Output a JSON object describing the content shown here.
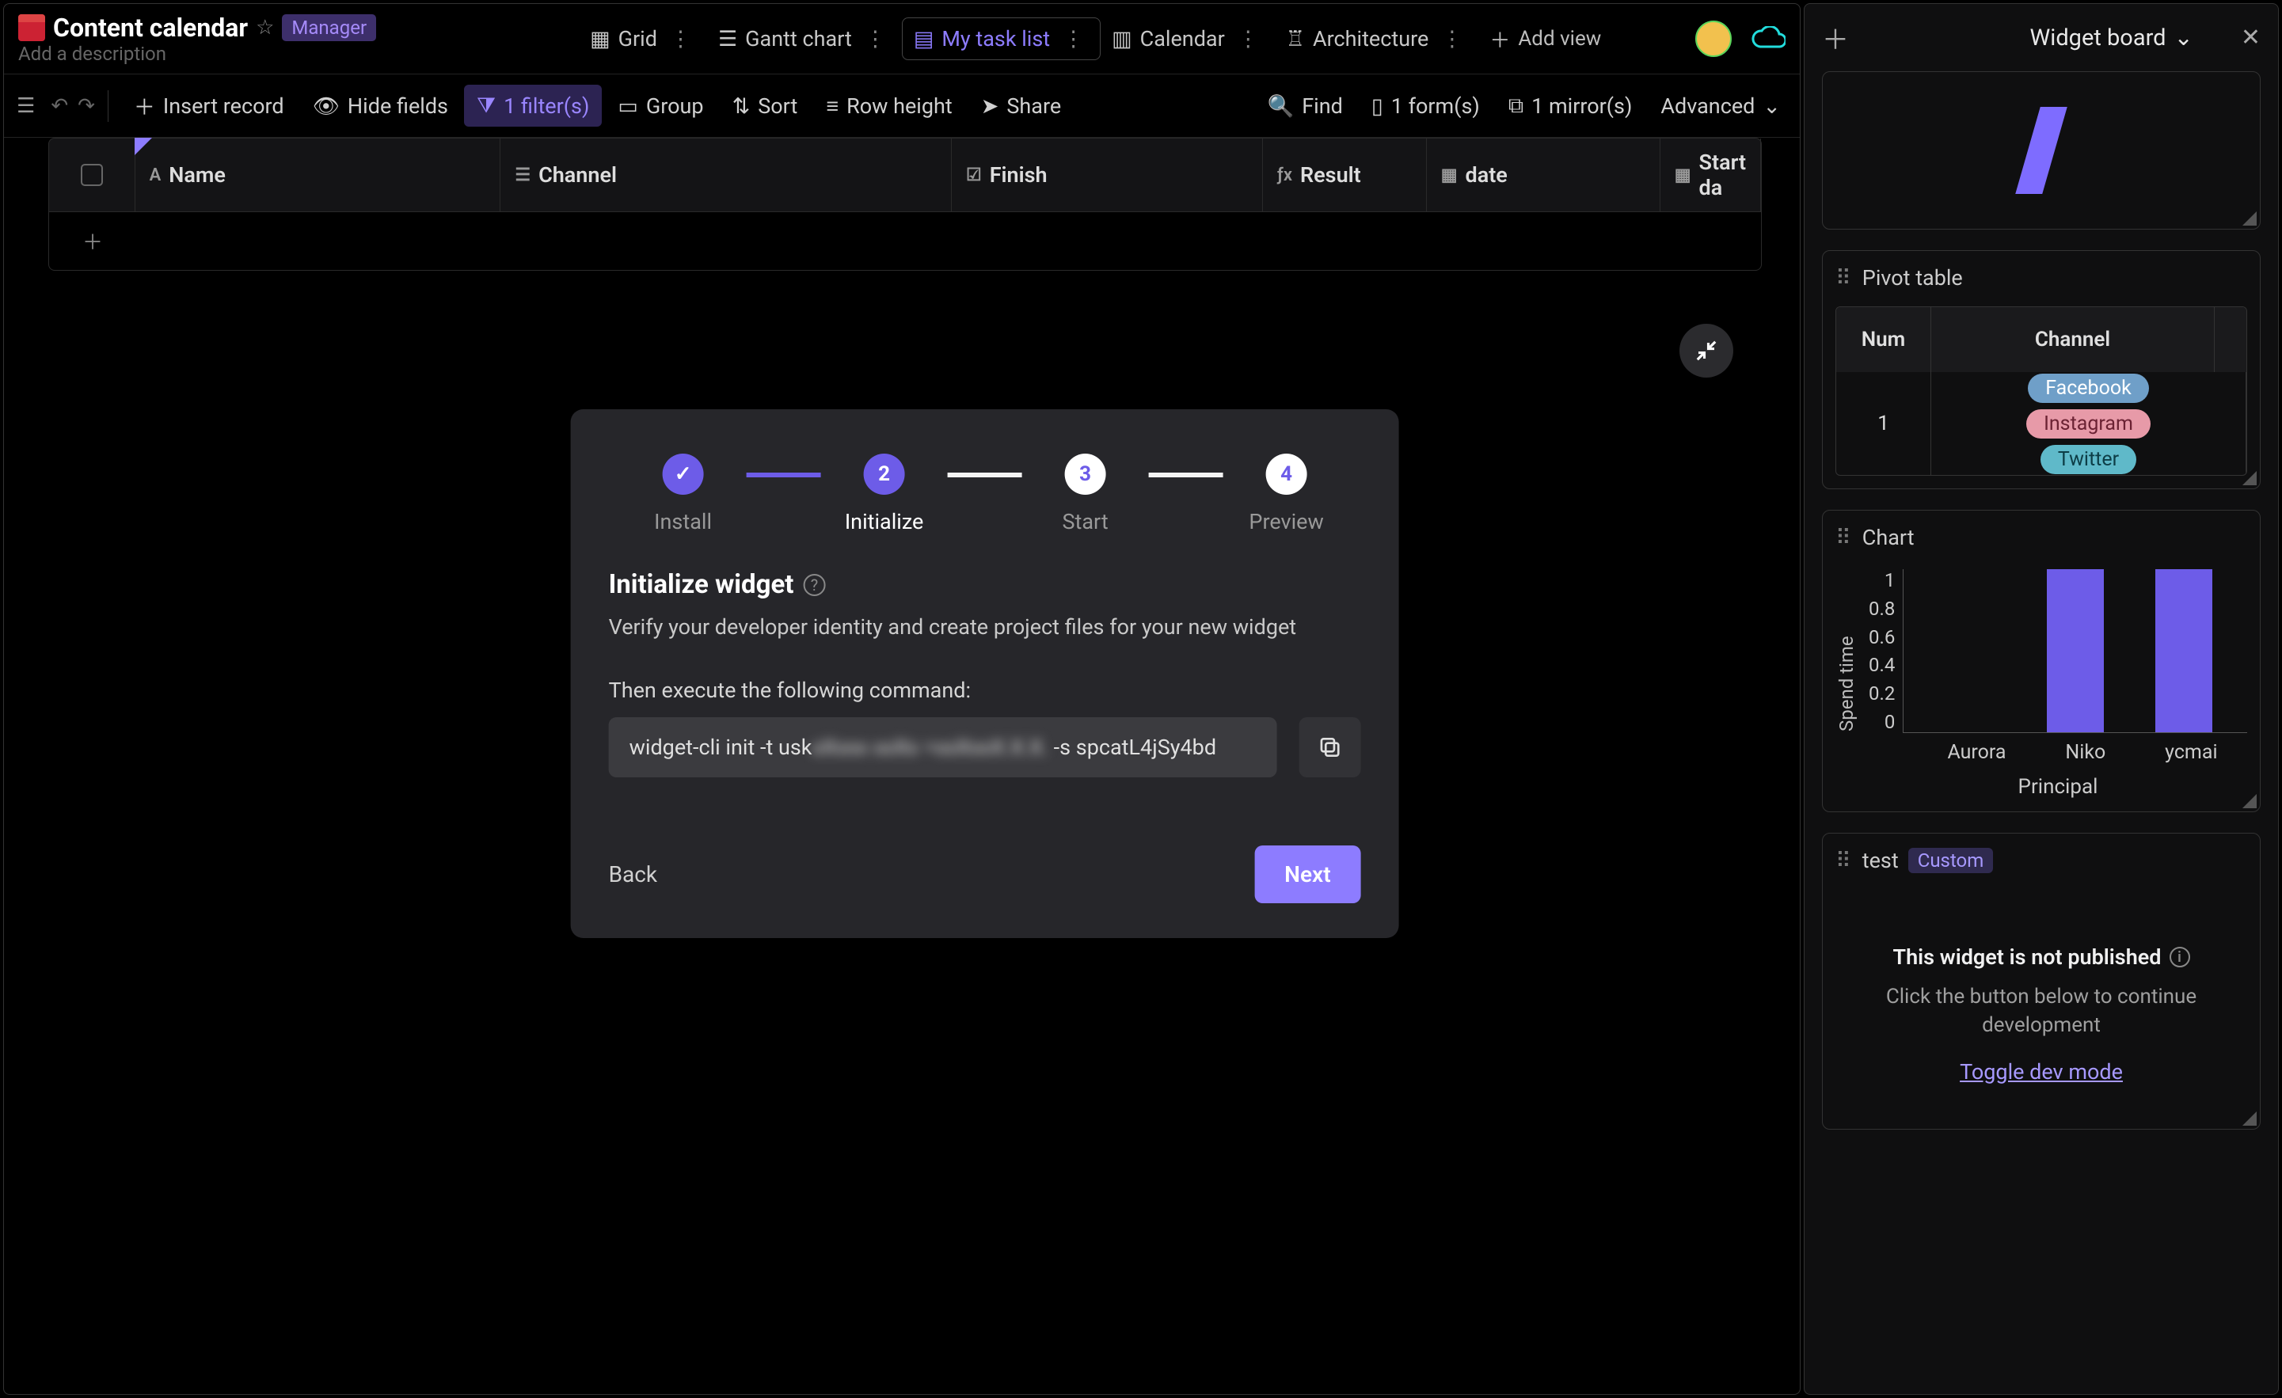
{
  "header": {
    "title": "Content calendar",
    "badge": "Manager",
    "description_placeholder": "Add a description"
  },
  "views": {
    "tabs": [
      {
        "id": "grid",
        "label": "Grid"
      },
      {
        "id": "gantt",
        "label": "Gantt chart"
      },
      {
        "id": "mytask",
        "label": "My task list",
        "active": true
      },
      {
        "id": "calendar",
        "label": "Calendar"
      },
      {
        "id": "arch",
        "label": "Architecture"
      }
    ],
    "add_view_label": "Add view"
  },
  "toolbar": {
    "insert_record": "Insert record",
    "hide_fields": "Hide fields",
    "filter": "1 filter(s)",
    "group": "Group",
    "sort": "Sort",
    "row_height": "Row height",
    "share": "Share",
    "find": "Find",
    "forms": "1 form(s)",
    "mirrors": "1 mirror(s)",
    "advanced": "Advanced"
  },
  "columns": {
    "name": "Name",
    "channel": "Channel",
    "finish": "Finish",
    "result": "Result",
    "date": "date",
    "start_date": "Start da"
  },
  "dialog": {
    "steps": [
      "Install",
      "Initialize",
      "Start",
      "Preview"
    ],
    "active_step_index": 1,
    "step_numbers": [
      "",
      "2",
      "3",
      "4"
    ],
    "title": "Initialize widget",
    "subtitle": "Verify your developer identity and create project files for your new widget",
    "instruction": "Then execute the following command:",
    "command_prefix": "widget-cli init -t usk",
    "command_blur": "xXxxx xxXx  =xxXxxX.X.X.",
    "command_suffix": " -s spcatL4jSy4bd",
    "back": "Back",
    "next": "Next"
  },
  "widget_panel": {
    "title": "Widget board",
    "cards": {
      "pivot": {
        "title": "Pivot table",
        "headers": {
          "num": "Num",
          "channel": "Channel"
        },
        "row": {
          "num": "1",
          "channels": [
            "Facebook",
            "Instagram",
            "Twitter"
          ]
        }
      },
      "chart": {
        "title": "Chart"
      },
      "test": {
        "title": "test",
        "badge": "Custom",
        "heading": "This widget is not published",
        "sub": "Click the button below to continue development",
        "link": "Toggle dev mode"
      }
    }
  },
  "chart_data": {
    "type": "bar",
    "categories": [
      "Aurora",
      "Niko",
      "ycmai"
    ],
    "values": [
      0,
      1,
      1
    ],
    "ylabel": "Spend time",
    "xlabel": "Principal",
    "ylim": [
      0,
      1
    ],
    "yticks": [
      1,
      0.8,
      0.6,
      0.4,
      0.2,
      0
    ]
  }
}
